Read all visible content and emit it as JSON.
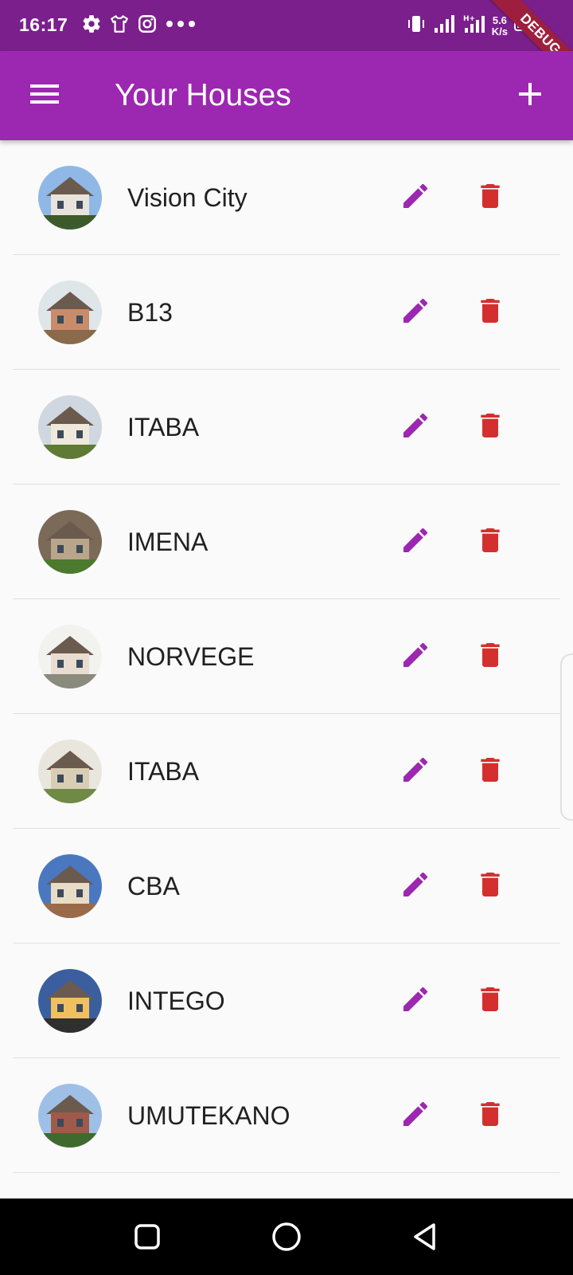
{
  "status_bar": {
    "time": "16:17",
    "left_icons": [
      "gear-icon",
      "shirt-icon",
      "instagram-icon",
      "more-dots-icon"
    ],
    "right_icons": [
      "vibrate-icon",
      "signal-icon",
      "signal-hplus-icon",
      "battery-icon"
    ],
    "net_speed_value": "5.6",
    "net_speed_unit": "K/s",
    "debug_banner": "DEBUG"
  },
  "app_bar": {
    "title": "Your Houses",
    "menu_icon": "menu-icon",
    "add_icon": "add-icon",
    "background": "#9c27b0"
  },
  "colors": {
    "status_bar": "#7b1f8c",
    "edit_icon": "#9c27b0",
    "delete_icon": "#d32f2f",
    "text": "#212121"
  },
  "houses": [
    {
      "name": "Vision City"
    },
    {
      "name": "B13"
    },
    {
      "name": "ITABA"
    },
    {
      "name": "IMENA"
    },
    {
      "name": "NORVEGE"
    },
    {
      "name": "ITABA"
    },
    {
      "name": "CBA"
    },
    {
      "name": "INTEGO"
    },
    {
      "name": "UMUTEKANO"
    }
  ],
  "row_actions": {
    "edit_icon": "edit-pencil-icon",
    "delete_icon": "trash-icon"
  },
  "nav_bar": {
    "buttons": [
      "recents-square-icon",
      "home-circle-icon",
      "back-triangle-icon"
    ]
  }
}
